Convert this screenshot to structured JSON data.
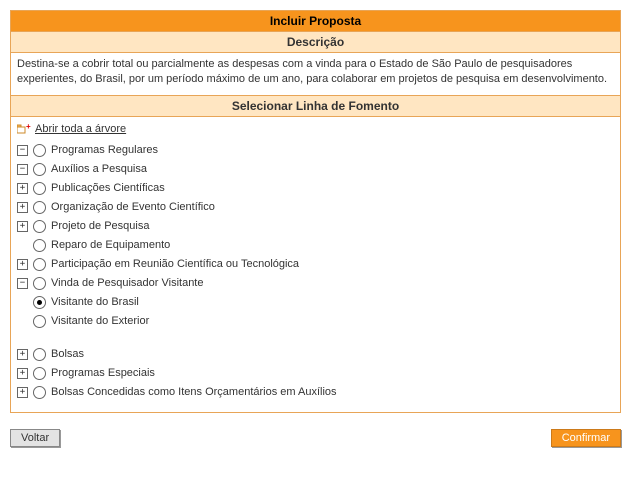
{
  "header": {
    "title": "Incluir Proposta",
    "sub_desc": "Descrição",
    "sub_tree": "Selecionar Linha de Fomento"
  },
  "description": "Destina-se a cobrir total ou parcialmente as despesas com a vinda para o Estado de São Paulo de pesquisadores experientes, do Brasil, por um período máximo de um ano, para colaborar em projetos de pesquisa em desenvolvimento.",
  "open_all": "Abrir toda a árvore",
  "tree": {
    "l0": "Programas Regulares",
    "l0_1": "Auxílios a Pesquisa",
    "l0_1_1": "Publicações Científicas",
    "l0_1_2": "Organização de Evento Científico",
    "l0_1_3": "Projeto de Pesquisa",
    "l0_1_4": "Reparo de Equipamento",
    "l0_1_5": "Participação em Reunião Científica ou Tecnológica",
    "l0_1_6": "Vinda de Pesquisador Visitante",
    "l0_1_6_1": "Visitante do Brasil",
    "l0_1_6_2": "Visitante do Exterior",
    "l0_2": "Bolsas",
    "l1": "Programas Especiais",
    "l2": "Bolsas Concedidas como Itens Orçamentários em Auxílios"
  },
  "buttons": {
    "back": "Voltar",
    "confirm": "Confirmar"
  }
}
